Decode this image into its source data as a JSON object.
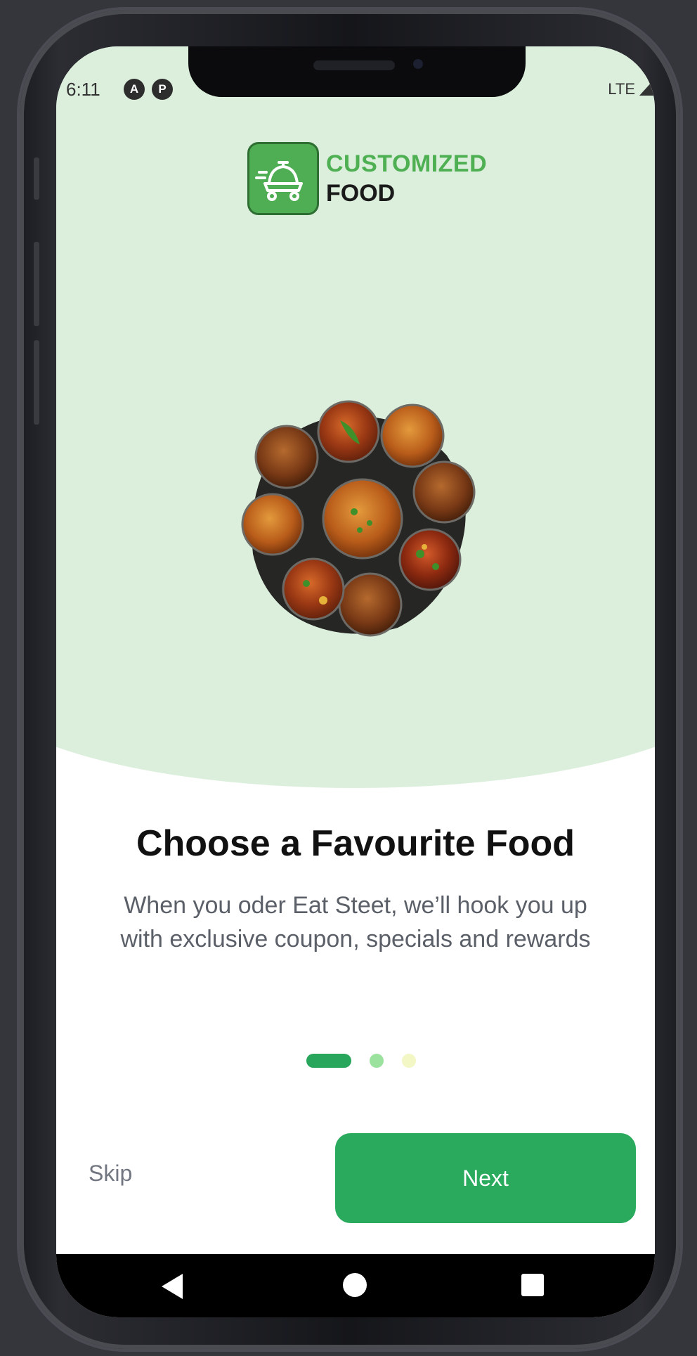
{
  "status_bar": {
    "time": "6:11",
    "icon_a": "A",
    "icon_b": "P",
    "network": "LTE"
  },
  "logo": {
    "line1": "CUSTOMIZED",
    "line2": "FOOD",
    "icon": "delivery-cloche-icon",
    "colors": {
      "accent": "#4fb053",
      "box": "#4fad54"
    }
  },
  "onboarding": {
    "title": "Choose a Favourite Food",
    "description": "When you oder Eat Steet, we’ll hook you up with exclusive coupon, specials and rewards",
    "pages_total": 3,
    "current_page": 1
  },
  "actions": {
    "skip_label": "Skip",
    "next_label": "Next"
  },
  "colors": {
    "primary": "#2aaa5d",
    "hero_bg": "#dcefdc",
    "dot_active": "#28a65c",
    "dot_2": "#9be29f",
    "dot_3": "#f3f7c6"
  },
  "nav_bar": {
    "back": "back-triangle-icon",
    "home": "home-circle-icon",
    "recents": "recents-square-icon"
  }
}
